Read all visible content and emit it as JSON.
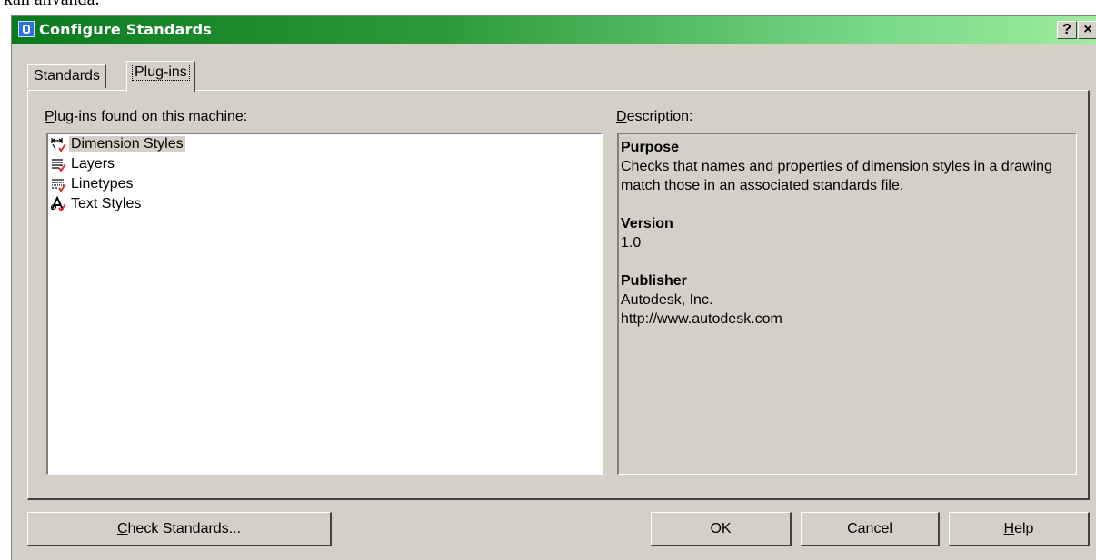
{
  "page_header_text": "kan anvanda.",
  "window": {
    "title": "Configure Standards",
    "help_glyph": "?",
    "close_glyph": "×"
  },
  "tabs": [
    {
      "label": "Standards",
      "active": false
    },
    {
      "label": "Plug-ins",
      "active": true
    }
  ],
  "plugins": {
    "label_accel": "P",
    "label_rest": "lug-ins found on this machine:",
    "items": [
      {
        "label": "Dimension Styles",
        "icon": "dimension-styles-icon",
        "selected": true
      },
      {
        "label": "Layers",
        "icon": "layers-icon",
        "selected": false
      },
      {
        "label": "Linetypes",
        "icon": "linetypes-icon",
        "selected": false
      },
      {
        "label": "Text Styles",
        "icon": "text-styles-icon",
        "selected": false
      }
    ]
  },
  "description": {
    "label_accel": "D",
    "label_rest": "escription:",
    "purpose_heading": "Purpose",
    "purpose_text": "Checks that names and properties of dimension styles in a drawing match those in an associated standards file.",
    "version_heading": "Version",
    "version_text": "1.0",
    "publisher_heading": "Publisher",
    "publisher_name": "Autodesk, Inc.",
    "publisher_url": "http://www.autodesk.com"
  },
  "buttons": {
    "check_accel": "C",
    "check_rest": "heck Standards...",
    "ok": "OK",
    "cancel": "Cancel",
    "help_accel": "H",
    "help_rest": "elp"
  },
  "colors": {
    "dialog_face": "#d4d0c8",
    "titlebar_start": "#0b7a1f",
    "titlebar_end": "#9cec9c",
    "check_mark": "#e02020"
  }
}
